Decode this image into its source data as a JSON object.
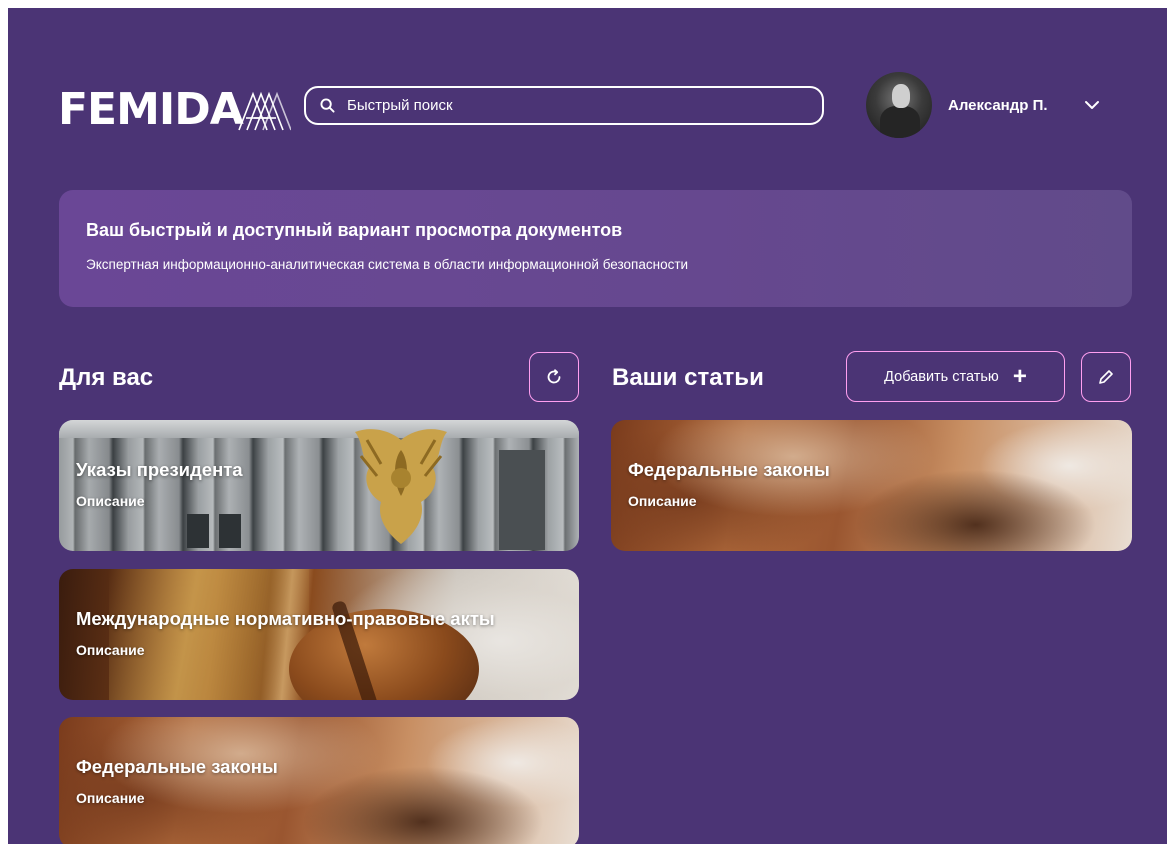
{
  "header": {
    "logo_text": "FEMIDA",
    "search": {
      "placeholder": "Быстрый поиск",
      "icon": "search-icon"
    },
    "user": {
      "name": "Александр П.",
      "avatar_icon": "avatar",
      "menu_icon": "chevron-down-icon"
    }
  },
  "hero": {
    "title": "Ваш быстрый и доступный вариант просмотра документов",
    "subtitle": "Экспертная информационно-аналитическая система в области информационной безопасности"
  },
  "for_you": {
    "title": "Для вас",
    "refresh_icon": "refresh-icon",
    "cards": [
      {
        "title": "Указы президента",
        "description": "Описание"
      },
      {
        "title": "Международные нормативно-правовые акты",
        "description": "Описание"
      },
      {
        "title": "Федеральные законы",
        "description": "Описание"
      }
    ]
  },
  "your_articles": {
    "title": "Ваши статьи",
    "add_label": "Добавить статью",
    "add_icon": "plus-icon",
    "edit_icon": "pencil-icon",
    "cards": [
      {
        "title": "Федеральные законы",
        "description": "Описание"
      }
    ]
  },
  "colors": {
    "background": "#4b3475",
    "hero_background": "#6a4796",
    "accent_border": "#ff9ff0",
    "text": "#ffffff"
  }
}
